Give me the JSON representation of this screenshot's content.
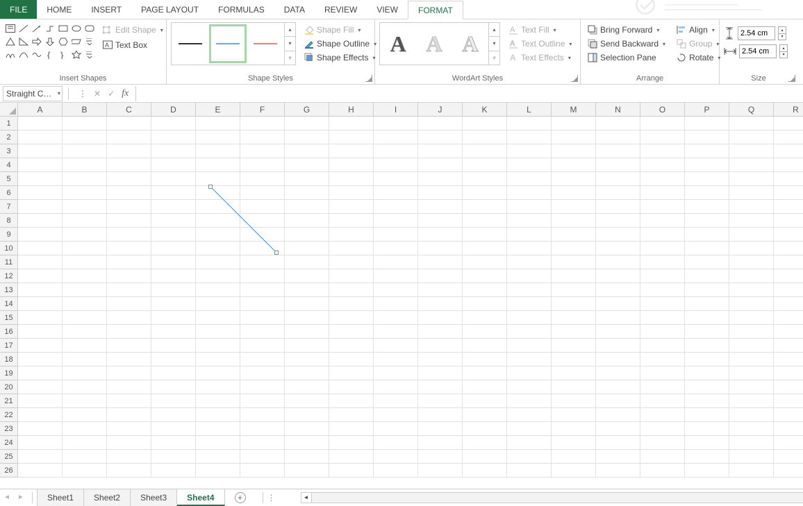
{
  "tabs": [
    "FILE",
    "HOME",
    "INSERT",
    "PAGE LAYOUT",
    "FORMULAS",
    "DATA",
    "REVIEW",
    "VIEW",
    "FORMAT"
  ],
  "activeTab": "FORMAT",
  "ribbon": {
    "insertShapes": {
      "label": "Insert Shapes",
      "editShape": "Edit Shape",
      "textBox": "Text Box"
    },
    "shapeStyles": {
      "label": "Shape Styles",
      "fill": "Shape Fill",
      "outline": "Shape Outline",
      "effects": "Shape Effects"
    },
    "wordArt": {
      "label": "WordArt Styles",
      "fill": "Text Fill",
      "outline": "Text Outline",
      "effects": "Text Effects"
    },
    "arrange": {
      "label": "Arrange",
      "forward": "Bring Forward",
      "backward": "Send Backward",
      "pane": "Selection Pane",
      "align": "Align",
      "group": "Group",
      "rotate": "Rotate"
    },
    "size": {
      "label": "Size",
      "height": "2.54 cm",
      "width": "2.54 cm"
    }
  },
  "nameBox": "Straight C…",
  "formula": "",
  "columns": [
    "A",
    "B",
    "C",
    "D",
    "E",
    "F",
    "G",
    "H",
    "I",
    "J",
    "K",
    "L",
    "M",
    "N",
    "O",
    "P",
    "Q",
    "R"
  ],
  "rowCount": 26,
  "sheets": [
    "Sheet1",
    "Sheet2",
    "Sheet3",
    "Sheet4"
  ],
  "activeSheet": "Sheet4"
}
